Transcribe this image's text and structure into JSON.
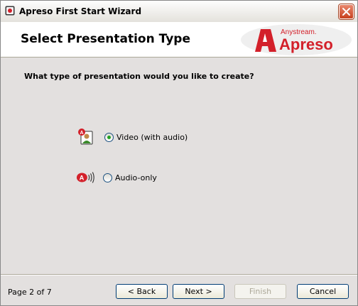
{
  "window": {
    "title": "Apreso First Start Wizard"
  },
  "header": {
    "page_title": "Select Presentation Type",
    "logo_brand": "Anystream.",
    "logo_product": "Apreso"
  },
  "body": {
    "question": "What type of presentation would you like to create?",
    "options": [
      {
        "label": "Video (with audio)",
        "selected": true,
        "icon": "video-presenter-icon"
      },
      {
        "label": "Audio-only",
        "selected": false,
        "icon": "audio-speaker-icon"
      }
    ]
  },
  "footer": {
    "page_indicator": "Page 2 of 7",
    "back_label": "< Back",
    "next_label": "Next >",
    "finish_label": "Finish",
    "cancel_label": "Cancel"
  },
  "colors": {
    "brand_red": "#d3202a",
    "body_bg": "#e3e0df"
  }
}
